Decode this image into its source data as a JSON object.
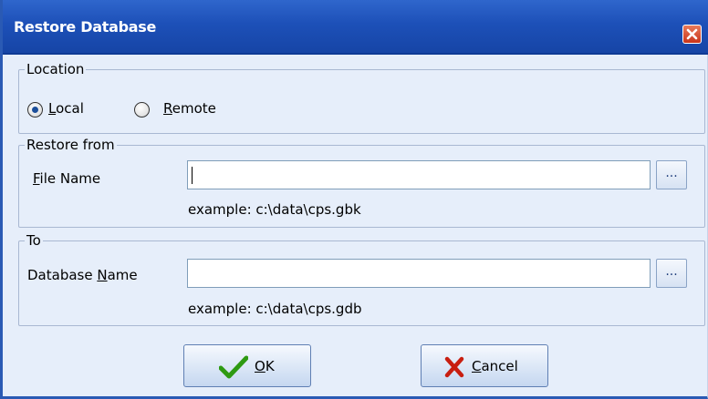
{
  "window": {
    "title": "Restore Database"
  },
  "location": {
    "legend": "Location",
    "options": [
      {
        "label": "Local",
        "accel": "L",
        "rest": "ocal",
        "selected": true
      },
      {
        "label": "Remote",
        "accel": "R",
        "rest": "emote",
        "selected": false
      }
    ]
  },
  "restore_from": {
    "legend": "Restore from",
    "field_label_accel": "F",
    "field_label_rest": "ile Name",
    "value": "",
    "browse_label": "...",
    "hint": "example: c:\\data\\cps.gbk"
  },
  "to": {
    "legend": "To",
    "field_label_pre": "Database ",
    "field_label_accel": "N",
    "field_label_rest": "ame",
    "value": "",
    "browse_label": "...",
    "hint": "example: c:\\data\\cps.gdb"
  },
  "buttons": {
    "ok": {
      "accel": "O",
      "rest": "K"
    },
    "cancel": {
      "accel": "C",
      "rest": "ancel"
    }
  },
  "colors": {
    "titlebar": "#1d50b8",
    "background": "#e6eefa",
    "ok_check": "#2e9a12",
    "cancel_x": "#c81e10"
  },
  "icons": {
    "close": "close-icon",
    "ok": "checkmark-icon",
    "cancel": "x-icon"
  }
}
